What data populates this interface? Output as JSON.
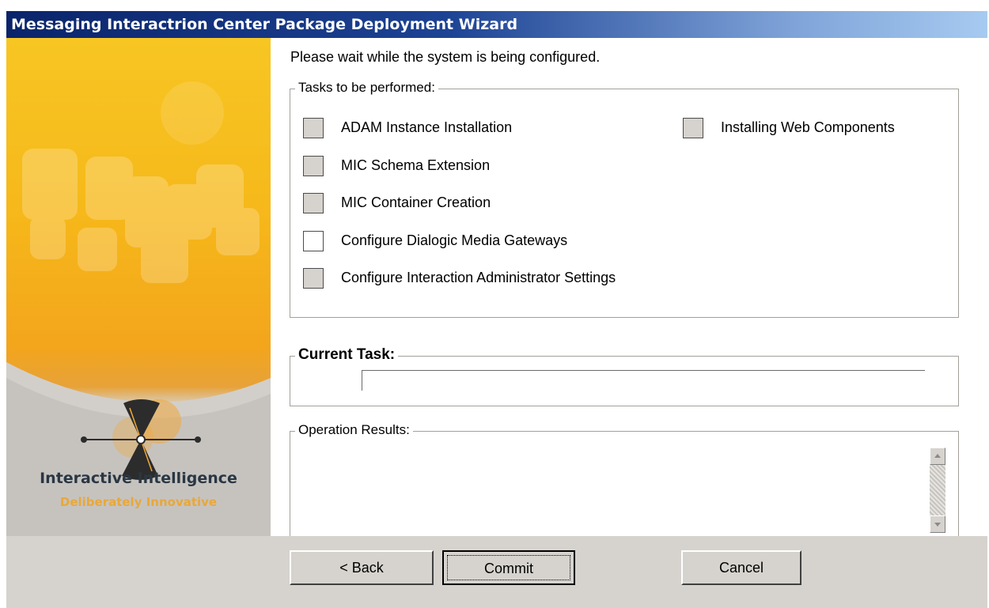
{
  "window": {
    "title": "Messaging Interactrion Center Package Deployment Wizard"
  },
  "brand": {
    "name": "Interactive Intelligence",
    "tagline": "Deliberately Innovative",
    "colors": {
      "orange": "#f3a51c",
      "navy": "#2a3744",
      "tagline": "#e8a83a"
    }
  },
  "main": {
    "status_text": "Please wait while the system is being configured.",
    "tasks_group": {
      "label": "Tasks to be performed:",
      "items": [
        {
          "label": "ADAM Instance Installation",
          "state": "pending"
        },
        {
          "label": "MIC Schema Extension",
          "state": "pending"
        },
        {
          "label": "MIC Container Creation",
          "state": "pending"
        },
        {
          "label": "Configure Dialogic Media Gateways",
          "state": "empty"
        },
        {
          "label": "Configure Interaction Administrator Settings",
          "state": "pending"
        },
        {
          "label": "Installing Web Components",
          "state": "pending"
        }
      ]
    },
    "current_task": {
      "label": "Current Task:",
      "value": ""
    },
    "results": {
      "label": "Operation Results:",
      "value": ""
    }
  },
  "footer": {
    "back_label": "< Back",
    "commit_label": "Commit",
    "cancel_label": "Cancel"
  }
}
